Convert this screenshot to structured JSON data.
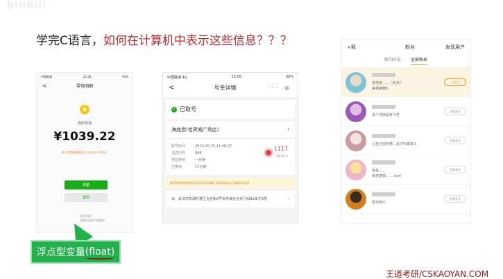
{
  "watermark": "bilibili",
  "title": {
    "prefix": "学完C语言，",
    "highlight": "如何在计算机中表示这些信息？？？"
  },
  "wallet": {
    "status_left": "中国联通",
    "status_time": "21:58",
    "status_right": "93%",
    "back": "<",
    "nav_title": "零钱明细",
    "coin_symbol": "¥",
    "label": "我的零钱",
    "amount": "¥1039.22",
    "promo": "转入零钱通赚收益 七日年化 2.46% ›",
    "btn_primary": "充值",
    "btn_secondary": "提现",
    "foot": "常见问题\n本服务由财付通提供"
  },
  "callout": {
    "prefix": "浮点型变量",
    "highlight": "(float)"
  },
  "queue": {
    "status_left": "中国联通 4G",
    "status_time": "22:05",
    "status_right": "99%",
    "back": "<",
    "nav_title": "号单详情",
    "nav_tools": "··· ◎",
    "taken": "已取号",
    "store": "海底捞(世界城广场店)",
    "rows": [
      {
        "k": "取号时间",
        "v": "2019-10-25 21:48:37"
      },
      {
        "k": "当前叫号",
        "v": "996"
      },
      {
        "k": "预估等待",
        "v": "一分钟"
      },
      {
        "k": "已等待",
        "v": "17分钟"
      }
    ],
    "number": "1117",
    "number_label": "小桌(两人)",
    "notice": "请您到叫号前提前到达点开号码通道【实际情况以门店情况为准】",
    "address": "武汉市东湖开发区光谷街3号世界城光谷步行街B1单元5层"
  },
  "fans": {
    "back": "<我",
    "nav_title": "粉丝",
    "nav_right": "发现用户",
    "tabs": [
      "新的好友",
      "全部粉丝"
    ],
    "items": [
      {
        "line1": "本地资……（乐天）",
        "line2": "来自荣耀6",
        "btn": "+关注",
        "colors": [
          "#7fc3d9",
          "#e8d8c8"
        ]
      },
      {
        "line1": "没个性就是有个性",
        "line2": "",
        "btn": "互相关注",
        "colors": [
          "#9b59b6",
          "#e0c0e8"
        ]
      },
      {
        "line1": "让自己快乐够…这才叫做意义",
        "line2": "",
        "btn": "互相关注",
        "colors": [
          "#c89ca0",
          "#f2e4e0"
        ]
      },
      {
        "line1": "晓晶……",
        "line2": "来自搜狐 ……com",
        "btn": "互相关注",
        "colors": [
          "#f0b6c8",
          "#ffe0a0"
        ]
      },
      {
        "line1": "暂无简介",
        "line2": "",
        "btn": "互相关注",
        "colors": [
          "#d08020",
          "#3a2a18"
        ]
      }
    ]
  },
  "footer": "王道考研/CSKAOYAN.COM"
}
